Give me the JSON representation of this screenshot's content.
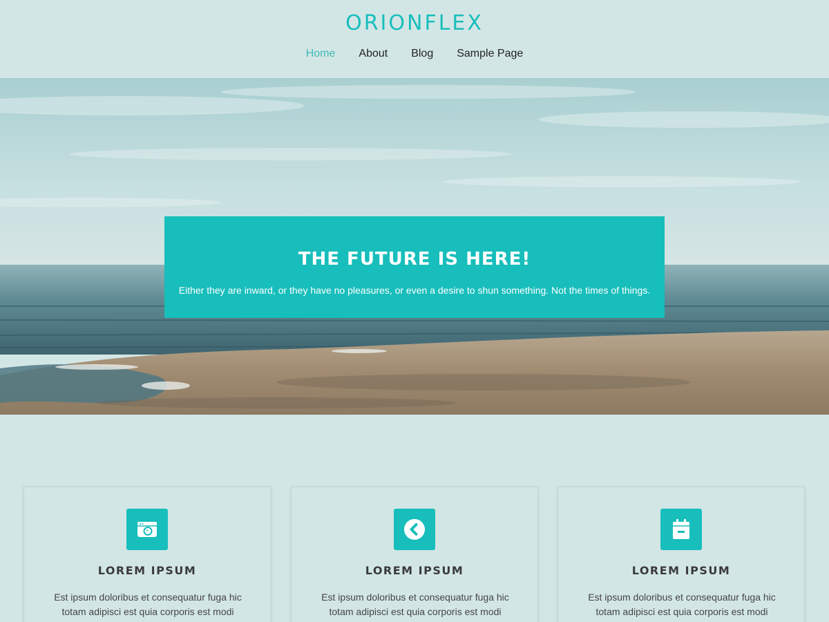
{
  "site": {
    "logo": "ORIONFLEX"
  },
  "nav": {
    "items": [
      {
        "label": "Home",
        "active": true
      },
      {
        "label": "About",
        "active": false
      },
      {
        "label": "Blog",
        "active": false
      },
      {
        "label": "Sample Page",
        "active": false
      }
    ]
  },
  "hero": {
    "title": "THE FUTURE IS HERE!",
    "text": "Either they are inward, or they have no pleasures, or even a desire to shun something. Not the times of things."
  },
  "features": [
    {
      "icon": "camera-icon",
      "title": "LOREM IPSUM",
      "text": "Est ipsum doloribus et consequatur fuga hic totam adipisci est quia corporis est modi"
    },
    {
      "icon": "chevron-left-circle-icon",
      "title": "LOREM IPSUM",
      "text": "Est ipsum doloribus et consequatur fuga hic totam adipisci est quia corporis est modi"
    },
    {
      "icon": "calendar-minus-icon",
      "title": "LOREM IPSUM",
      "text": "Est ipsum doloribus et consequatur fuga hic totam adipisci est quia corporis est modi"
    }
  ],
  "colors": {
    "accent": "#17bebb",
    "background": "#d3e6e6",
    "nav_active": "#3fb8b6"
  }
}
